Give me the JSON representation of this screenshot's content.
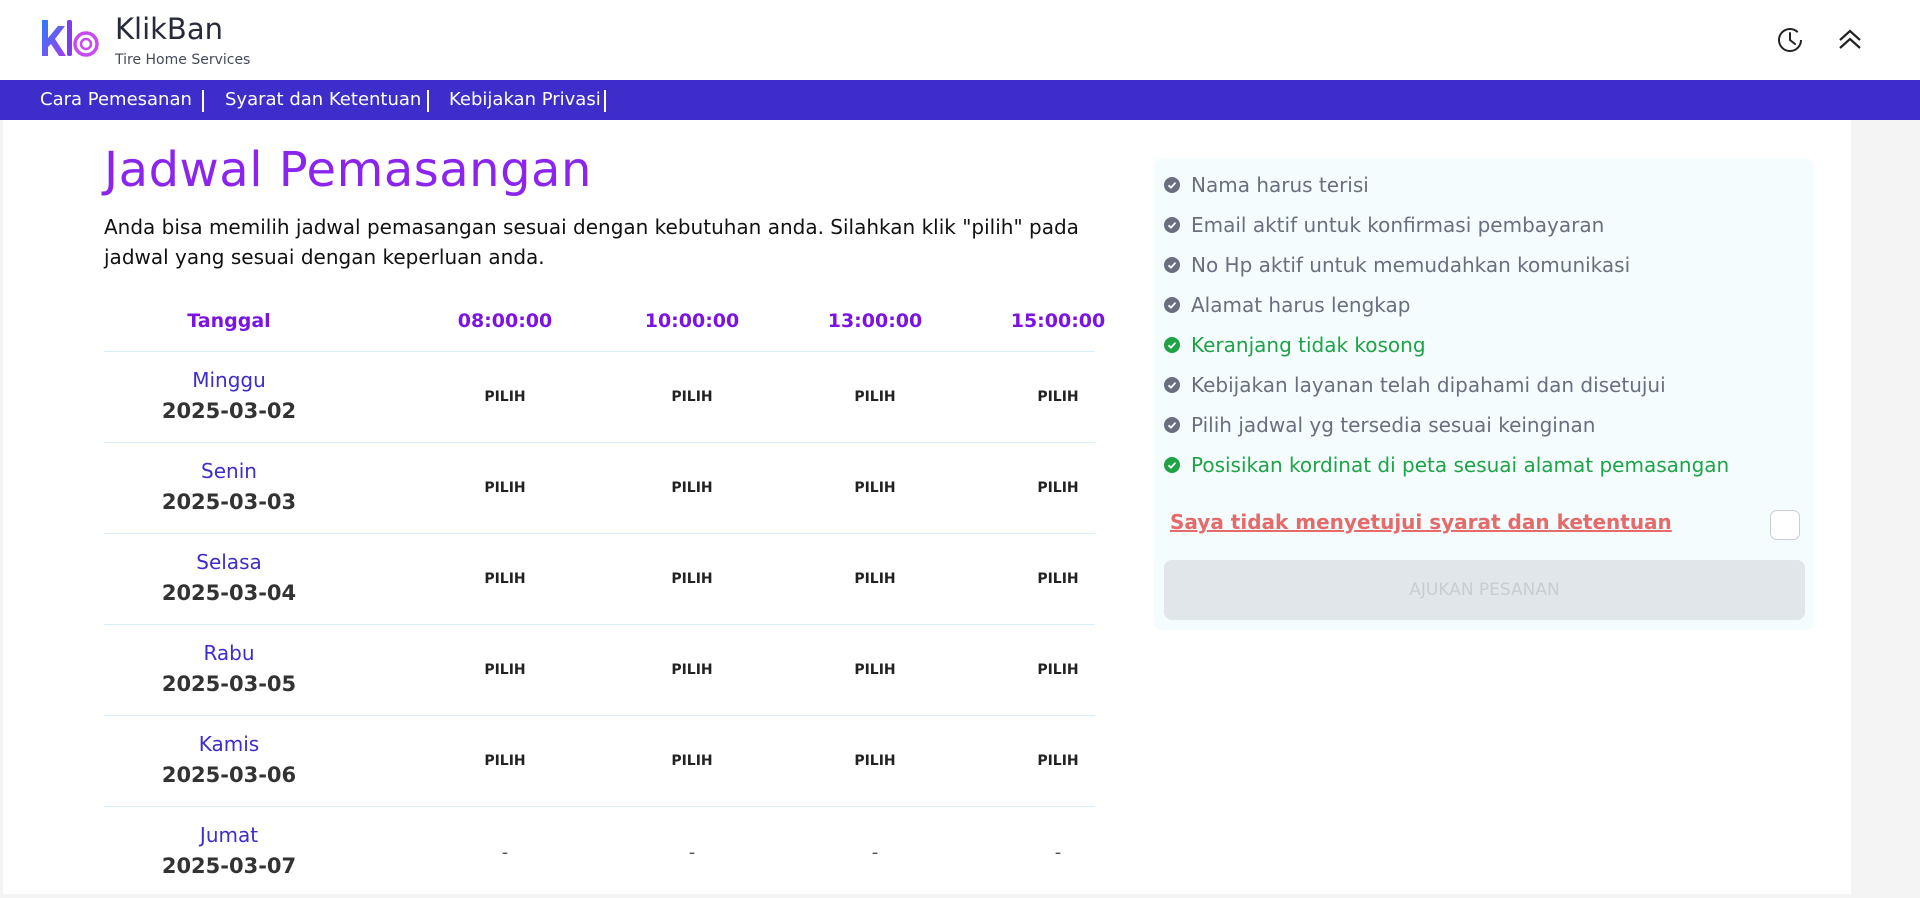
{
  "brand": {
    "name": "KlikBan",
    "tagline": "Tire Home Services"
  },
  "header_icons": [
    "history-clock-icon",
    "chevron-up-icon"
  ],
  "nav": {
    "items": [
      "Cara Pemesanan",
      "Syarat dan Ketentuan",
      "Kebijakan Privasi"
    ]
  },
  "schedule": {
    "title": "Jadwal Pemasangan",
    "intro": "Anda bisa memilih jadwal pemasangan sesuai dengan kebutuhan anda. Silahkan klik \"pilih\" pada jadwal yang sesuai dengan keperluan anda.",
    "headers": [
      "Tanggal",
      "08:00:00",
      "10:00:00",
      "13:00:00",
      "15:00:00"
    ],
    "rows": [
      {
        "day": "Minggu",
        "date": "2025-03-02",
        "slots": [
          "PILIH",
          "PILIH",
          "PILIH",
          "PILIH"
        ]
      },
      {
        "day": "Senin",
        "date": "2025-03-03",
        "slots": [
          "PILIH",
          "PILIH",
          "PILIH",
          "PILIH"
        ]
      },
      {
        "day": "Selasa",
        "date": "2025-03-04",
        "slots": [
          "PILIH",
          "PILIH",
          "PILIH",
          "PILIH"
        ]
      },
      {
        "day": "Rabu",
        "date": "2025-03-05",
        "slots": [
          "PILIH",
          "PILIH",
          "PILIH",
          "PILIH"
        ]
      },
      {
        "day": "Kamis",
        "date": "2025-03-06",
        "slots": [
          "PILIH",
          "PILIH",
          "PILIH",
          "PILIH"
        ]
      },
      {
        "day": "Jumat",
        "date": "2025-03-07",
        "slots": [
          "-",
          "-",
          "-",
          "-"
        ]
      }
    ]
  },
  "checklist": [
    {
      "text": "Nama harus terisi",
      "done": false
    },
    {
      "text": "Email aktif untuk konfirmasi pembayaran",
      "done": false
    },
    {
      "text": "No Hp aktif untuk memudahkan komunikasi",
      "done": false
    },
    {
      "text": "Alamat harus lengkap",
      "done": false
    },
    {
      "text": "Keranjang tidak kosong",
      "done": true
    },
    {
      "text": "Kebijakan layanan telah dipahami dan disetujui",
      "done": false
    },
    {
      "text": "Pilih jadwal yg tersedia sesuai keinginan",
      "done": false
    },
    {
      "text": "Posisikan kordinat di peta sesuai alamat pemasangan",
      "done": true
    }
  ],
  "terms": {
    "disagree_label": "Saya tidak menyetujui syarat dan ketentuan",
    "agreed": false
  },
  "submit_label": "AJUKAN PESANAN",
  "colors": {
    "nav_bg": "#3d2dcb",
    "title": "#8b25ee",
    "header_text": "#7b14e0",
    "day_text": "#3d2dcb",
    "check_done": "#1fa347",
    "check_pending": "#6a6f80",
    "disagree": "#e56a6a"
  }
}
